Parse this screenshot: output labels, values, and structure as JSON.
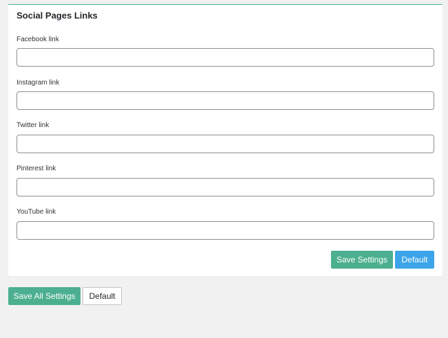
{
  "panel": {
    "title": "Social Pages Links",
    "fields": [
      {
        "label": "Facebook link",
        "value": "",
        "placeholder": ""
      },
      {
        "label": "Instagram link",
        "value": "",
        "placeholder": ""
      },
      {
        "label": "Twitter link",
        "value": "",
        "placeholder": ""
      },
      {
        "label": "Pinterest link",
        "value": "",
        "placeholder": ""
      },
      {
        "label": "YouTube link",
        "value": "",
        "placeholder": ""
      }
    ],
    "save_label": "Save Settings",
    "default_label": "Default"
  },
  "footer": {
    "save_all_label": "Save All Settings",
    "default_label": "Default"
  },
  "colors": {
    "accent_green": "#4caf8f",
    "accent_blue": "#3ba4ea",
    "background": "#f1f1f1"
  }
}
